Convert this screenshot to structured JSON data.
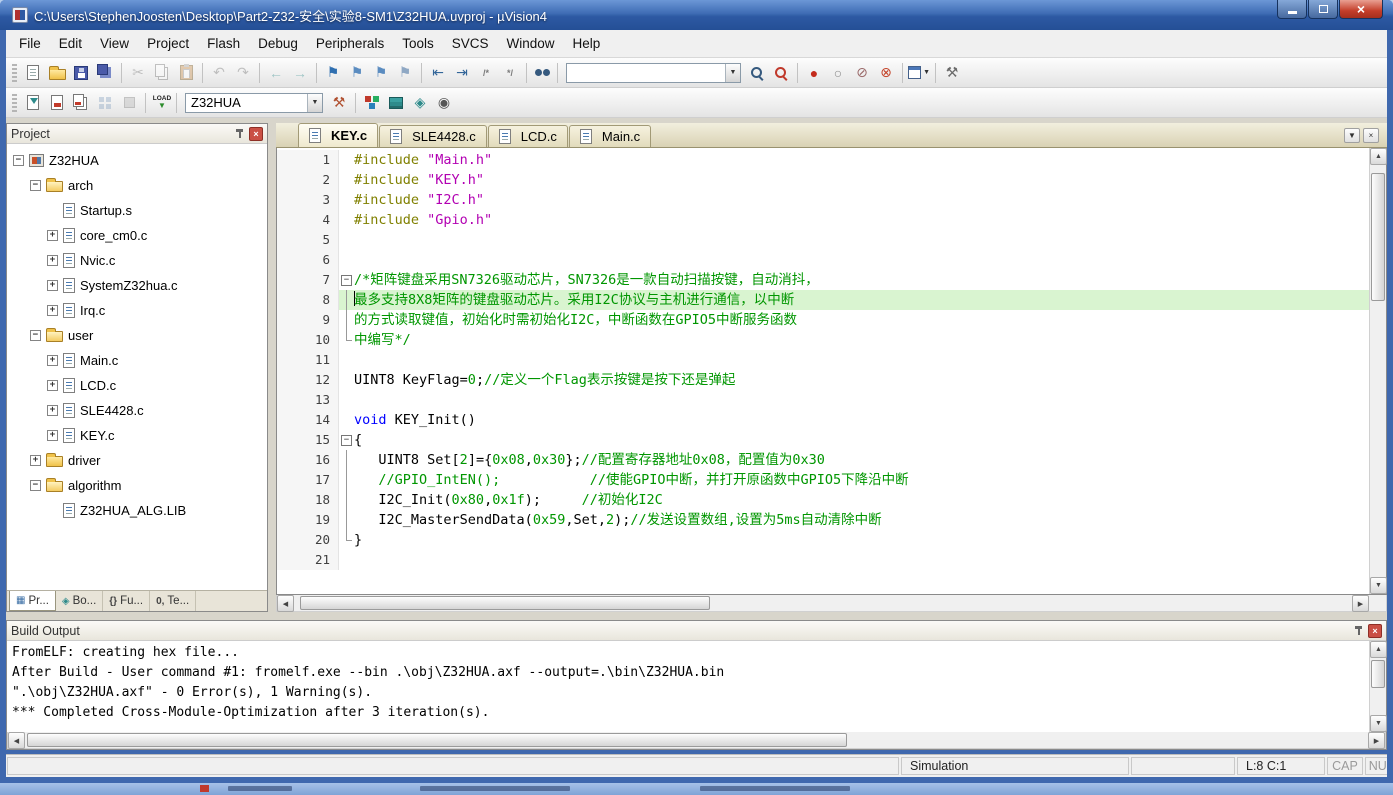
{
  "window": {
    "title": "C:\\Users\\StephenJoosten\\Desktop\\Part2-Z32-安全\\实验8-SM1\\Z32HUA.uvproj - µVision4"
  },
  "menu": {
    "items": [
      "File",
      "Edit",
      "View",
      "Project",
      "Flash",
      "Debug",
      "Peripherals",
      "Tools",
      "SVCS",
      "Window",
      "Help"
    ]
  },
  "colors": {
    "keyword": "#0000ff",
    "string": "#b200b2",
    "comment": "#009600",
    "number": "#009600",
    "preprocessor": "#808000",
    "line_highlight": "#d9f4d0",
    "title_bar": "#3e6cb4"
  },
  "toolbar1": {
    "find_value": "",
    "left_groups": [
      [
        {
          "name": "new-file-icon",
          "cls": "ic-page"
        },
        {
          "name": "open-file-icon",
          "cls": "ic-folder"
        },
        {
          "name": "save-icon",
          "cls": "ic-save"
        },
        {
          "name": "save-all-icon",
          "cls": "ic-saveall"
        }
      ],
      [
        {
          "name": "cut-icon",
          "g": "✂",
          "c": "#7a7a7a",
          "dim": true
        },
        {
          "name": "copy-icon",
          "cls": "ic-copy",
          "dim": true
        },
        {
          "name": "paste-icon",
          "cls": "ic-paste",
          "dim": true
        }
      ],
      [
        {
          "name": "undo-icon",
          "g": "↶",
          "c": "#7a7a7a",
          "dim": true
        },
        {
          "name": "redo-icon",
          "g": "↷",
          "c": "#7a7a7a",
          "dim": true
        }
      ],
      [
        {
          "name": "nav-back-icon",
          "g": "←",
          "c": "#2e8b8b",
          "dim": true
        },
        {
          "name": "nav-forward-icon",
          "g": "→",
          "c": "#2e8b8b",
          "dim": true
        }
      ],
      [
        {
          "name": "bookmark-toggle-icon",
          "g": "⚑",
          "c": "#2f6fb0"
        },
        {
          "name": "bookmark-prev-icon",
          "g": "⚑",
          "c": "#5b8cc0"
        },
        {
          "name": "bookmark-next-icon",
          "g": "⚑",
          "c": "#5b8cc0"
        },
        {
          "name": "bookmark-clear-all-icon",
          "g": "⚑",
          "c": "#8fa8c4"
        }
      ],
      [
        {
          "name": "indent-left-icon",
          "g": "⇤",
          "c": "#336699"
        },
        {
          "name": "indent-right-icon",
          "g": "⇥",
          "c": "#336699"
        },
        {
          "name": "comment-selection-icon",
          "g": "/*",
          "c": "#7a7a7a",
          "small": true
        },
        {
          "name": "uncomment-selection-icon",
          "g": "*/",
          "c": "#7a7a7a",
          "small": true
        }
      ],
      [
        {
          "name": "find-in-files-icon",
          "cls": "ic-binoc"
        }
      ]
    ],
    "right_groups": [
      [
        {
          "name": "find-icon",
          "cls": "ic-mag"
        },
        {
          "name": "incremental-find-icon",
          "cls": "ic-magred"
        }
      ],
      [
        {
          "name": "toggle-breakpoint-icon",
          "g": "●",
          "c": "#c42b1c"
        },
        {
          "name": "enable-disable-breakpoint-icon",
          "g": "○",
          "c": "#8a8a8a"
        },
        {
          "name": "disable-all-breakpoints-icon",
          "g": "⊘",
          "c": "#9a6a6a"
        },
        {
          "name": "kill-all-breakpoints-icon",
          "g": "⊗",
          "c": "#c4452b"
        }
      ],
      [
        {
          "name": "window-layout-icon",
          "cls": "ic-winbox",
          "dd": true
        }
      ],
      [
        {
          "name": "configure-tools-icon",
          "g": "⚒",
          "c": "#6a6a6a"
        }
      ]
    ]
  },
  "toolbar2": {
    "target": "Z32HUA",
    "left_groups": [
      [
        {
          "name": "translate-file-icon",
          "cls": "ic-translate"
        },
        {
          "name": "build-target-icon",
          "cls": "ic-build"
        },
        {
          "name": "rebuild-all-icon",
          "cls": "ic-rebuild"
        },
        {
          "name": "batch-build-icon",
          "cls": "ic-batch",
          "dim": true
        },
        {
          "name": "stop-build-icon",
          "cls": "ic-stop",
          "dim": true
        }
      ],
      [
        {
          "name": "download-icon",
          "cls": "ic-load",
          "txt": "LOAD"
        }
      ]
    ],
    "right_groups": [
      [
        {
          "name": "target-options-icon",
          "g": "⚒",
          "c": "#b05030"
        }
      ],
      [
        {
          "name": "manage-components-icon",
          "cls": "ic-blocks"
        },
        {
          "name": "manage-books-icon",
          "cls": "ic-bookstack"
        },
        {
          "name": "software-packs-icon",
          "g": "◈",
          "c": "#2e8b8b"
        },
        {
          "name": "environment-icon",
          "g": "◉",
          "c": "#555555"
        }
      ]
    ]
  },
  "project": {
    "title": "Project",
    "tree": [
      {
        "depth": 0,
        "exp": "minus",
        "icon": "target",
        "label": "Z32HUA"
      },
      {
        "depth": 1,
        "exp": "minus",
        "icon": "folder-open",
        "label": "arch"
      },
      {
        "depth": 2,
        "exp": "none",
        "icon": "file",
        "label": "Startup.s"
      },
      {
        "depth": 2,
        "exp": "plus",
        "icon": "file",
        "label": "core_cm0.c"
      },
      {
        "depth": 2,
        "exp": "plus",
        "icon": "file",
        "label": "Nvic.c"
      },
      {
        "depth": 2,
        "exp": "plus",
        "icon": "file",
        "label": "SystemZ32hua.c"
      },
      {
        "depth": 2,
        "exp": "plus",
        "icon": "file",
        "label": "Irq.c"
      },
      {
        "depth": 1,
        "exp": "minus",
        "icon": "folder-open",
        "label": "user"
      },
      {
        "depth": 2,
        "exp": "plus",
        "icon": "file",
        "label": "Main.c"
      },
      {
        "depth": 2,
        "exp": "plus",
        "icon": "file",
        "label": "LCD.c"
      },
      {
        "depth": 2,
        "exp": "plus",
        "icon": "file",
        "label": "SLE4428.c"
      },
      {
        "depth": 2,
        "exp": "plus",
        "icon": "file",
        "label": "KEY.c"
      },
      {
        "depth": 1,
        "exp": "plus",
        "icon": "folder",
        "label": "driver"
      },
      {
        "depth": 1,
        "exp": "minus",
        "icon": "folder-open",
        "label": "algorithm"
      },
      {
        "depth": 2,
        "exp": "none",
        "icon": "file",
        "label": "Z32HUA_ALG.LIB"
      }
    ],
    "bottom_tabs": [
      {
        "name": "project-tab",
        "label": "Pr...",
        "icon": "▦",
        "ic": "#3a6ea5",
        "active": true
      },
      {
        "name": "books-tab",
        "label": "Bo...",
        "icon": "◈",
        "ic": "#2e8b8b",
        "active": false
      },
      {
        "name": "functions-tab",
        "label": "Fu...",
        "icon": "{}",
        "ic": "#444444",
        "active": false
      },
      {
        "name": "templates-tab",
        "label": "Te...",
        "icon": "0,",
        "ic": "#444444",
        "active": false
      }
    ]
  },
  "editor": {
    "tabs": [
      {
        "label": "KEY.c",
        "active": true
      },
      {
        "label": "SLE4428.c",
        "active": false
      },
      {
        "label": "LCD.c",
        "active": false
      },
      {
        "label": "Main.c",
        "active": false
      }
    ],
    "lines": [
      {
        "n": 1,
        "seg": [
          [
            "#include ",
            "pp"
          ],
          [
            "\"Main.h\"",
            "str"
          ]
        ]
      },
      {
        "n": 2,
        "seg": [
          [
            "#include ",
            "pp"
          ],
          [
            "\"KEY.h\"",
            "str"
          ]
        ]
      },
      {
        "n": 3,
        "seg": [
          [
            "#include ",
            "pp"
          ],
          [
            "\"I2C.h\"",
            "str"
          ]
        ]
      },
      {
        "n": 4,
        "seg": [
          [
            "#include ",
            "pp"
          ],
          [
            "\"Gpio.h\"",
            "str"
          ]
        ]
      },
      {
        "n": 5,
        "seg": []
      },
      {
        "n": 6,
        "seg": []
      },
      {
        "n": 7,
        "f": "box",
        "seg": [
          [
            "/*矩阵键盘采用SN7326驱动芯片，SN7326是一款自动扫描按键，自动消抖，",
            "com"
          ]
        ]
      },
      {
        "n": 8,
        "f": "line",
        "hl": true,
        "caret": true,
        "seg": [
          [
            "最多支持8X8矩阵的键盘驱动芯片。采用I2C协议与主机进行通信，以中断",
            "com"
          ]
        ]
      },
      {
        "n": 9,
        "f": "line",
        "seg": [
          [
            "的方式读取键值，初始化时需初始化I2C，中断函数在GPIO5中断服务函数",
            "com"
          ]
        ]
      },
      {
        "n": 10,
        "f": "end",
        "seg": [
          [
            "中编写*/",
            "com"
          ]
        ]
      },
      {
        "n": 11,
        "seg": []
      },
      {
        "n": 12,
        "seg": [
          [
            "UINT8 KeyFlag=",
            "pl"
          ],
          [
            "0",
            "num"
          ],
          [
            ";",
            "pl"
          ],
          [
            "//定义一个Flag表示按键是按下还是弹起",
            "com"
          ]
        ]
      },
      {
        "n": 13,
        "seg": []
      },
      {
        "n": 14,
        "seg": [
          [
            "void",
            "kw"
          ],
          [
            " KEY_Init()",
            "pl"
          ]
        ]
      },
      {
        "n": 15,
        "f": "box",
        "seg": [
          [
            "{",
            "pl"
          ]
        ]
      },
      {
        "n": 16,
        "f": "line",
        "seg": [
          [
            "   UINT8 Set[",
            "pl"
          ],
          [
            "2",
            "num"
          ],
          [
            "]={",
            "pl"
          ],
          [
            "0x08",
            "num"
          ],
          [
            ",",
            "pl"
          ],
          [
            "0x30",
            "num"
          ],
          [
            "};",
            "pl"
          ],
          [
            "//配置寄存器地址0x08，配置值为0x30",
            "com"
          ]
        ]
      },
      {
        "n": 17,
        "f": "line",
        "seg": [
          [
            "   ",
            "pl"
          ],
          [
            "//GPIO_IntEN();           //使能GPIO中断，并打开原函数中GPIO5下降沿中断",
            "com"
          ]
        ]
      },
      {
        "n": 18,
        "f": "line",
        "seg": [
          [
            "   I2C_Init(",
            "pl"
          ],
          [
            "0x80",
            "num"
          ],
          [
            ",",
            "pl"
          ],
          [
            "0x1f",
            "num"
          ],
          [
            ");     ",
            "pl"
          ],
          [
            "//初始化I2C",
            "com"
          ]
        ]
      },
      {
        "n": 19,
        "f": "line",
        "seg": [
          [
            "   I2C_MasterSendData(",
            "pl"
          ],
          [
            "0x59",
            "num"
          ],
          [
            ",Set,",
            "pl"
          ],
          [
            "2",
            "num"
          ],
          [
            ");",
            "pl"
          ],
          [
            "//发送设置数组,设置为5ms自动清除中断",
            "com"
          ]
        ]
      },
      {
        "n": 20,
        "f": "end",
        "seg": [
          [
            "}",
            "pl"
          ]
        ]
      },
      {
        "n": 21,
        "seg": []
      }
    ]
  },
  "build_output": {
    "title": "Build Output",
    "lines": [
      "FromELF: creating hex file...",
      "After Build - User command #1: fromelf.exe --bin .\\obj\\Z32HUA.axf --output=.\\bin\\Z32HUA.bin",
      "\".\\obj\\Z32HUA.axf\" - 0 Error(s), 1 Warning(s).",
      "*** Completed Cross-Module-Optimization after 3 iteration(s)."
    ]
  },
  "status": {
    "mode": "Simulation",
    "cursor": "L:8 C:1",
    "caps": "CAP",
    "num": "NUM"
  }
}
